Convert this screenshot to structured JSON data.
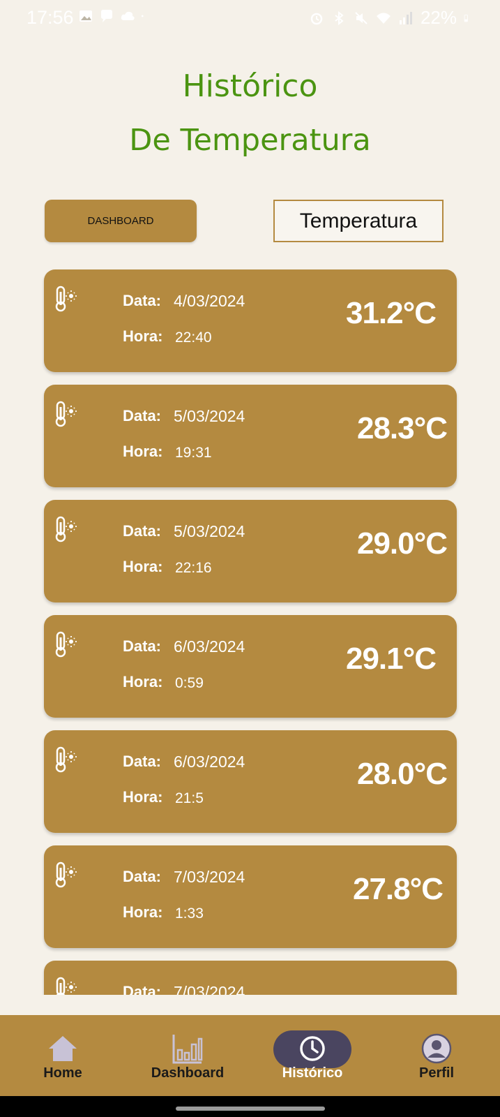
{
  "status_bar": {
    "time": "17:56",
    "battery": "22%",
    "left_icons": [
      "image-icon",
      "chat-icon",
      "cloud-icon",
      "dot-icon"
    ],
    "right_icons": [
      "alarm-icon",
      "bluetooth-icon",
      "mute-icon",
      "wifi-icon",
      "signal-icon",
      "battery-icon"
    ]
  },
  "header": {
    "title_line1": "Histórico",
    "title_line2": "De Temperatura",
    "title_color": "#4b9411"
  },
  "controls": {
    "dashboard_button": "DASHBOARD",
    "temperature_label": "Temperatura"
  },
  "labels": {
    "data": "Data:",
    "hora": "Hora:"
  },
  "records": [
    {
      "date": "4/03/2024",
      "time": "22:40",
      "temp": "31.2°C"
    },
    {
      "date": "5/03/2024",
      "time": "19:31",
      "temp": "28.3°C"
    },
    {
      "date": "5/03/2024",
      "time": "22:16",
      "temp": "29.0°C"
    },
    {
      "date": "6/03/2024",
      "time": "0:59",
      "temp": "29.1°C"
    },
    {
      "date": "6/03/2024",
      "time": "21:5",
      "temp": "28.0°C"
    },
    {
      "date": "7/03/2024",
      "time": "1:33",
      "temp": "27.8°C"
    },
    {
      "date": "7/03/2024",
      "time": "",
      "temp": ""
    }
  ],
  "bottom_nav": {
    "items": [
      {
        "label": "Home",
        "icon": "home-icon"
      },
      {
        "label": "Dashboard",
        "icon": "bar-chart-icon"
      },
      {
        "label": "Histórico",
        "icon": "clock-icon",
        "active": true
      },
      {
        "label": "Perfil",
        "icon": "profile-icon"
      }
    ]
  },
  "colors": {
    "background": "#f5f1e9",
    "card": "#b48a40",
    "active_nav": "#4a4560"
  }
}
